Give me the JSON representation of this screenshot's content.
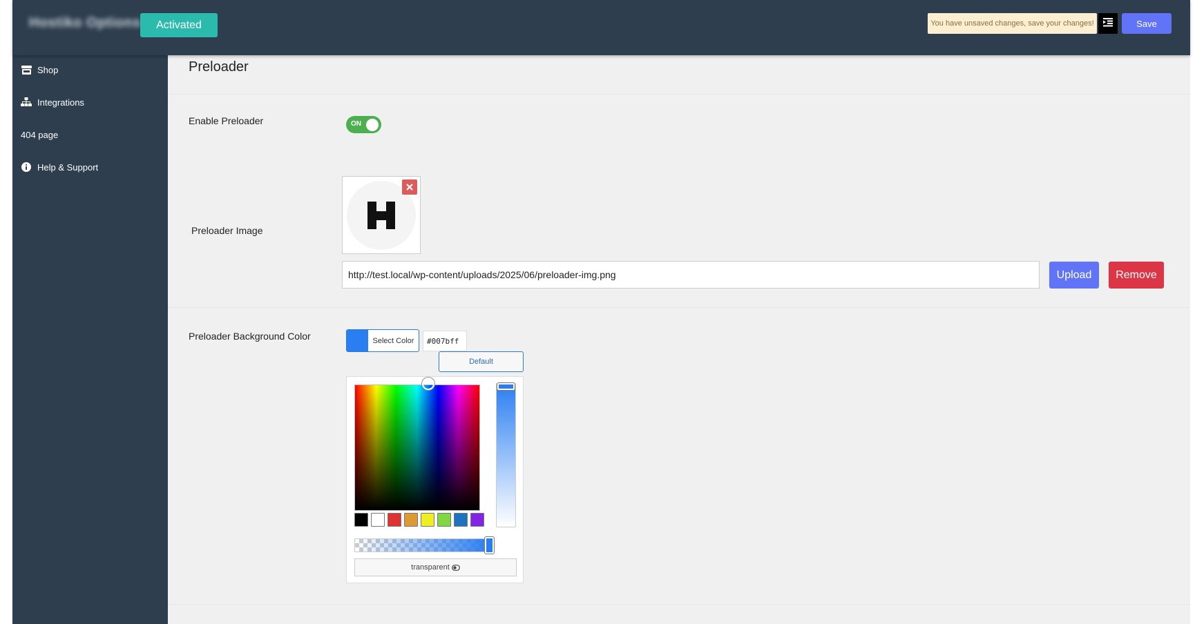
{
  "header": {
    "brand": "Hostiko Options",
    "activated_label": "Activated",
    "unsaved_notice": "You have unsaved changes, save your changes!",
    "save_label": "Save"
  },
  "sidebar": {
    "items": [
      {
        "label": "Shop",
        "icon": "store-icon"
      },
      {
        "label": "Integrations",
        "icon": "sitemap-icon"
      },
      {
        "label": "404 page",
        "icon": ""
      },
      {
        "label": "Help & Support",
        "icon": "info-circle-icon"
      }
    ]
  },
  "main": {
    "title": "Preloader",
    "enable_preloader": {
      "label": "Enable Preloader",
      "toggle_text": "ON",
      "enabled": true
    },
    "preloader_image": {
      "label": "Preloader Image",
      "url": "http://test.local/wp-content/uploads/2025/06/preloader-img.png",
      "preview_letter": "H",
      "upload_label": "Upload",
      "remove_label": "Remove"
    },
    "background_color": {
      "label": "Preloader Background Color",
      "select_label": "Select Color",
      "hex_value": "#007bff",
      "default_label": "Default",
      "transparent_label": "transparent",
      "palette": [
        "#000000",
        "#ffffff",
        "#dd3333",
        "#dd9933",
        "#eeee22",
        "#81d742",
        "#1e73be",
        "#8224e3"
      ]
    }
  },
  "colors": {
    "header_bg": "#2e3e4f",
    "accent": "#6174f7",
    "activated": "#2bbbad",
    "toggle_on": "#4caf50",
    "danger": "#dc3545"
  }
}
